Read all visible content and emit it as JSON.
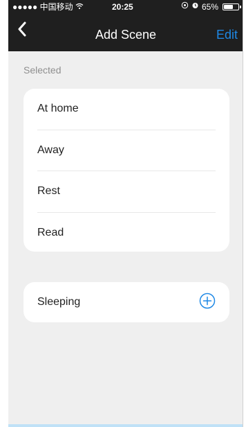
{
  "colors": {
    "header_bg": "#1f1f1f",
    "page_bg": "#efefef",
    "accent": "#1e88e5",
    "label_gray": "#8f8f8f"
  },
  "status_bar": {
    "carrier": "●●●●● 中国移动 ",
    "wifi_icon": "wifi-icon",
    "time": "20:25",
    "battery_level": 0.65,
    "battery_text": "65%"
  },
  "header": {
    "title": "Add Scene",
    "edit_label": "Edit",
    "back_icon": "chevron-left-icon"
  },
  "selected_section": {
    "label": "Selected",
    "items": [
      {
        "label": "At home"
      },
      {
        "label": "Away"
      },
      {
        "label": "Rest"
      },
      {
        "label": "Read"
      }
    ]
  },
  "available_section": {
    "items": [
      {
        "label": "Sleeping",
        "icon": "add-circle-icon"
      }
    ]
  }
}
